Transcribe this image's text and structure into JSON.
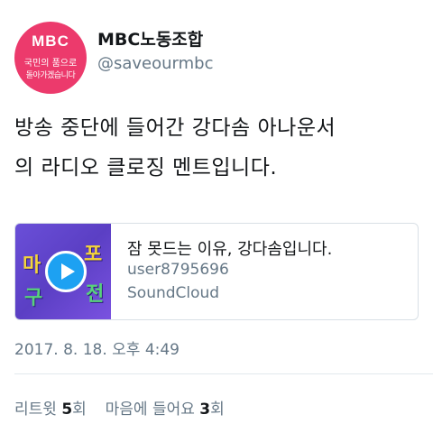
{
  "user": {
    "name": "MBC노동조합",
    "handle": "@saveourmbc",
    "avatar": {
      "logo": "MBC",
      "line1": "국민의 품으로",
      "line2": "돌아가겠습니다"
    }
  },
  "tweet": {
    "lines": [
      "방송 중단에 들어간 강다솜 아나운서",
      "의 라디오 클로징 멘트입니다."
    ]
  },
  "card": {
    "thumbnail_text": [
      "마",
      "포",
      "구",
      "전"
    ],
    "title": "잠 못드는 이유, 강다솜입니다.",
    "subtitle": "user8795696",
    "site": "SoundCloud",
    "play_color": "#1da1f2"
  },
  "timestamp": "2017. 8. 18. 오후 4:49",
  "stats": {
    "retweets_label": "리트윗",
    "retweets_count": "5",
    "retweets_unit": "회",
    "likes_label": "마음에 들어요",
    "likes_count": "3",
    "likes_unit": "회"
  },
  "colors": {
    "avatar_bg": "#ec3a6c",
    "secondary_text": "#657786",
    "accent": "#1da1f2"
  }
}
